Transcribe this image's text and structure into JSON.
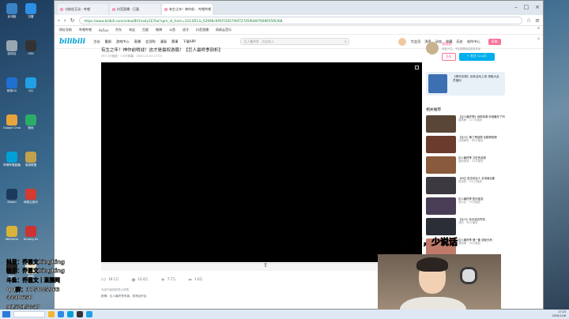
{
  "desktop": {
    "icons": [
      {
        "label": "此电脑",
        "color": "#3b82c4"
      },
      {
        "label": "回收站",
        "color": "#9aa7b3"
      },
      {
        "label": "网易UU",
        "color": "#1f6fd1"
      },
      {
        "label": "Google Chrome",
        "color": "#e8a43b"
      },
      {
        "label": "哔哩哔哩直播姬",
        "color": "#00a1d6"
      },
      {
        "label": "Steam",
        "color": "#1b3a5c"
      },
      {
        "label": "WeGame",
        "color": "#d9b23a"
      },
      {
        "label": "Epic",
        "color": "#222"
      },
      {
        "label": "迅雷",
        "color": "#2d8fe6"
      },
      {
        "label": "OBS",
        "color": "#333"
      },
      {
        "label": "QQ",
        "color": "#21a0e6"
      },
      {
        "label": "微信",
        "color": "#2aae67"
      },
      {
        "label": "英雄联盟",
        "color": "#c2a14e"
      },
      {
        "label": "网易云音乐",
        "color": "#d43c33"
      },
      {
        "label": "Among Us",
        "color": "#c33"
      },
      {
        "label": "原神",
        "color": "#e7e0c8"
      }
    ]
  },
  "browser": {
    "tabs": [
      {
        "label": "与粉丝互动 - 哔哩"
      },
      {
        "label": "抖音直播 - 巨量"
      },
      {
        "label": "有生之年！神作前... 哔哩哔哩",
        "active": true
      }
    ],
    "url": "https://www.bilibili.com/video/BV1ha4y1E7tw?spm_id_from=333.851.b_62696c695f7265706f72745f6d6f7669655f6368",
    "bookmarks": [
      "网址导航",
      "哔哩哔哩",
      "AcFun",
      "京东",
      "淘宝",
      "百度",
      "微博",
      "斗鱼",
      "虎牙",
      "抖音直播",
      "网易云音乐"
    ]
  },
  "site": {
    "logo": "bilibili",
    "nav": [
      "主站",
      "番剧",
      "游戏中心",
      "直播",
      "会员购",
      "漫画",
      "赛事",
      "下载APP"
    ],
    "search_placeholder": "巨人最终季 · 点击进入",
    "right_nav": [
      "大会员",
      "消息",
      "动态",
      "收藏",
      "历史",
      "创作中心"
    ],
    "upload_label": "投稿"
  },
  "video": {
    "title": "有生之年！神作前哨战！这才是最权游篇！【巨人最终季剖析】",
    "meta": "297.3万播放 · 2.6万弹幕 · 2020-12-01 17:23",
    "actions": [
      {
        "icon": "thumb-up-icon",
        "value": "16.1万"
      },
      {
        "icon": "coin-icon",
        "value": "12.4万"
      },
      {
        "icon": "star-icon",
        "value": "7.7万"
      },
      {
        "icon": "share-icon",
        "value": "1.0万"
      }
    ],
    "desc_line1": "未经作者授权禁止转载",
    "desc_line2": "剧情：巨人最终季来袭，前哨战开启"
  },
  "up": {
    "name": "雷鹰桑",
    "desc": "动漫UP主，不定期更新高质量作品",
    "charge_label": "充电",
    "follow_label": "+ 关注 12.4万"
  },
  "ad": {
    "text": "【周年庆典】全新活动上线 领取大会员福利"
  },
  "related": {
    "heading": "相关推荐",
    "items": [
      {
        "title": "【巨人最终季】地鸣来袭 你准备好了吗",
        "meta": "雷鹰桑 · 127万播放",
        "color": "#5a4636"
      },
      {
        "title": "【巨人】第三季回顾 全剧情梳理",
        "meta": "动漫解说 · 88万播放",
        "color": "#6b3b2e"
      },
      {
        "title": "巨人最终季 艾伦的选择",
        "meta": "番剧速递 · 54万播放",
        "color": "#8a5a3c"
      },
      {
        "title": "【4K】进击的巨人 名场面合集",
        "meta": "剪辑君 · 201万播放",
        "color": "#3c3a40"
      },
      {
        "title": "巨人最终季 配乐鉴赏",
        "meta": "音乐区 · 33万播放",
        "color": "#4a3d56"
      },
      {
        "title": "【巨人】兵长高光时刻",
        "meta": "漫剪 · 96万播放",
        "color": "#2b2e36"
      },
      {
        "title": "巨人最终季 第一集 逐帧分析",
        "meta": "雷鹰桑 · 76万播放",
        "color": "#c07a6a"
      },
      {
        "title": "最终季 马莱篇 人物关系",
        "meta": "科普区 · 41万播放",
        "color": "#5b4c3e"
      }
    ]
  },
  "overlays": {
    "caption": "拔牙肿了，少说话",
    "lines": [
      "抖音：乔恩文kingking",
      "快手：乔恩文kingking",
      "斗鱼：乔恩文｜直播间",
      "QQ群：375085963",
      "4440650",
      "915215847"
    ]
  },
  "taskbar": {
    "time": "17:23",
    "date": "2020/12/6"
  }
}
